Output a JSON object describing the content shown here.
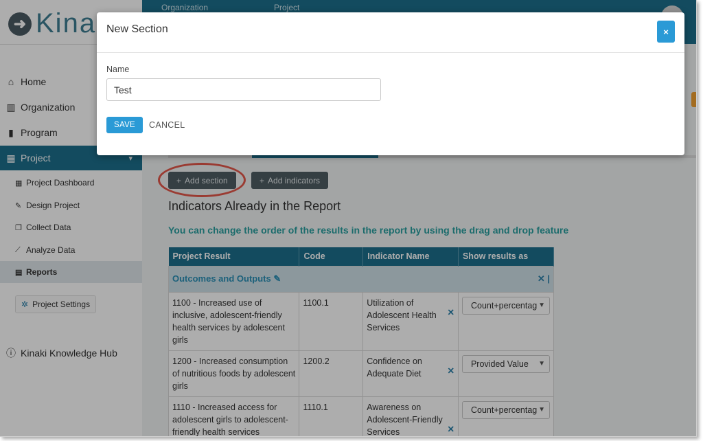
{
  "app": {
    "logo_text": "Kina"
  },
  "sidebar": {
    "items": [
      {
        "label": "Home",
        "icon": "home-icon"
      },
      {
        "label": "Organization",
        "icon": "building-icon"
      },
      {
        "label": "Program",
        "icon": "bars-icon"
      },
      {
        "label": "Project",
        "icon": "grid-icon"
      }
    ],
    "sub_items": [
      {
        "label": "Project Dashboard",
        "icon": "dashboard-icon"
      },
      {
        "label": "Design Project",
        "icon": "pencil-icon"
      },
      {
        "label": "Collect Data",
        "icon": "copy-icon"
      },
      {
        "label": "Analyze Data",
        "icon": "chart-icon"
      },
      {
        "label": "Reports",
        "icon": "file-icon"
      }
    ],
    "settings_label": "Project Settings",
    "hub_label": "Kinaki Knowledge Hub"
  },
  "topbar": {
    "crumb_org": "Organization",
    "crumb_project": "Project"
  },
  "actions": {
    "add_section": "Add section",
    "add_indicators": "Add indicators"
  },
  "report": {
    "heading": "Indicators Already in the Report",
    "note": "You can change the order of the results in the report by using the drag and drop feature",
    "columns": [
      "Project Result",
      "Code",
      "Indicator Name",
      "Show results as"
    ],
    "section_title": "Outcomes and Outputs",
    "rows": [
      {
        "result": "1100 - Increased use of inclusive, adolescent-friendly health services by adolescent girls",
        "code": "1100.1",
        "indicator": "Utilization of Adolescent Health Services",
        "show": "Count+percentag"
      },
      {
        "result": "1200 - Increased consumption of nutritious foods by adolescent girls",
        "code": "1200.2",
        "indicator": "Confidence on Adequate Diet",
        "show": "Provided Value"
      },
      {
        "result": "1110 - Increased access for adolescent girls to adolescent-friendly health services",
        "code": "1110.1",
        "indicator": "Awareness on Adolescent-Friendly Services",
        "show": "Count+percentag"
      }
    ]
  },
  "modal": {
    "title": "New Section",
    "close": "×",
    "name_label": "Name",
    "name_value": "Test",
    "save": "SAVE",
    "cancel": "CANCEL"
  },
  "colors": {
    "brand": "#1d6f8c",
    "primary_button": "#2a9ad6",
    "highlight_circle": "#e4584b"
  }
}
